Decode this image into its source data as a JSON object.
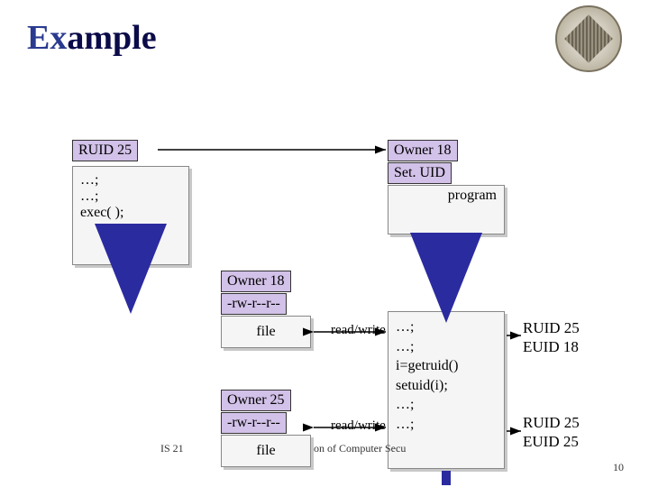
{
  "title": {
    "part1": "Ex",
    "part2": "ample"
  },
  "process1": {
    "header": "RUID 25",
    "body_lines": [
      "…;",
      "…;",
      "exec(  );"
    ]
  },
  "program": {
    "header1": "Owner 18",
    "header2": "Set. UID",
    "label": "program"
  },
  "file1": {
    "header1": "Owner 18",
    "header2": "-rw-r--r--",
    "label": "file",
    "rw": "read/write"
  },
  "file2": {
    "header1": "Owner 25",
    "header2": "-rw-r--r--",
    "label": "file",
    "rw": "read/write"
  },
  "process2": {
    "body_lines": [
      "…;",
      "…;",
      "i=getruid()",
      "setuid(i);",
      "…;",
      "…;"
    ]
  },
  "rightlabels": {
    "top": {
      "l1": "RUID 25",
      "l2": "EUID 18"
    },
    "bot": {
      "l1": "RUID 25",
      "l2": "EUID 25"
    }
  },
  "footer": {
    "left": "IS 21",
    "mid": "on of Computer Secu",
    "page": "10"
  }
}
